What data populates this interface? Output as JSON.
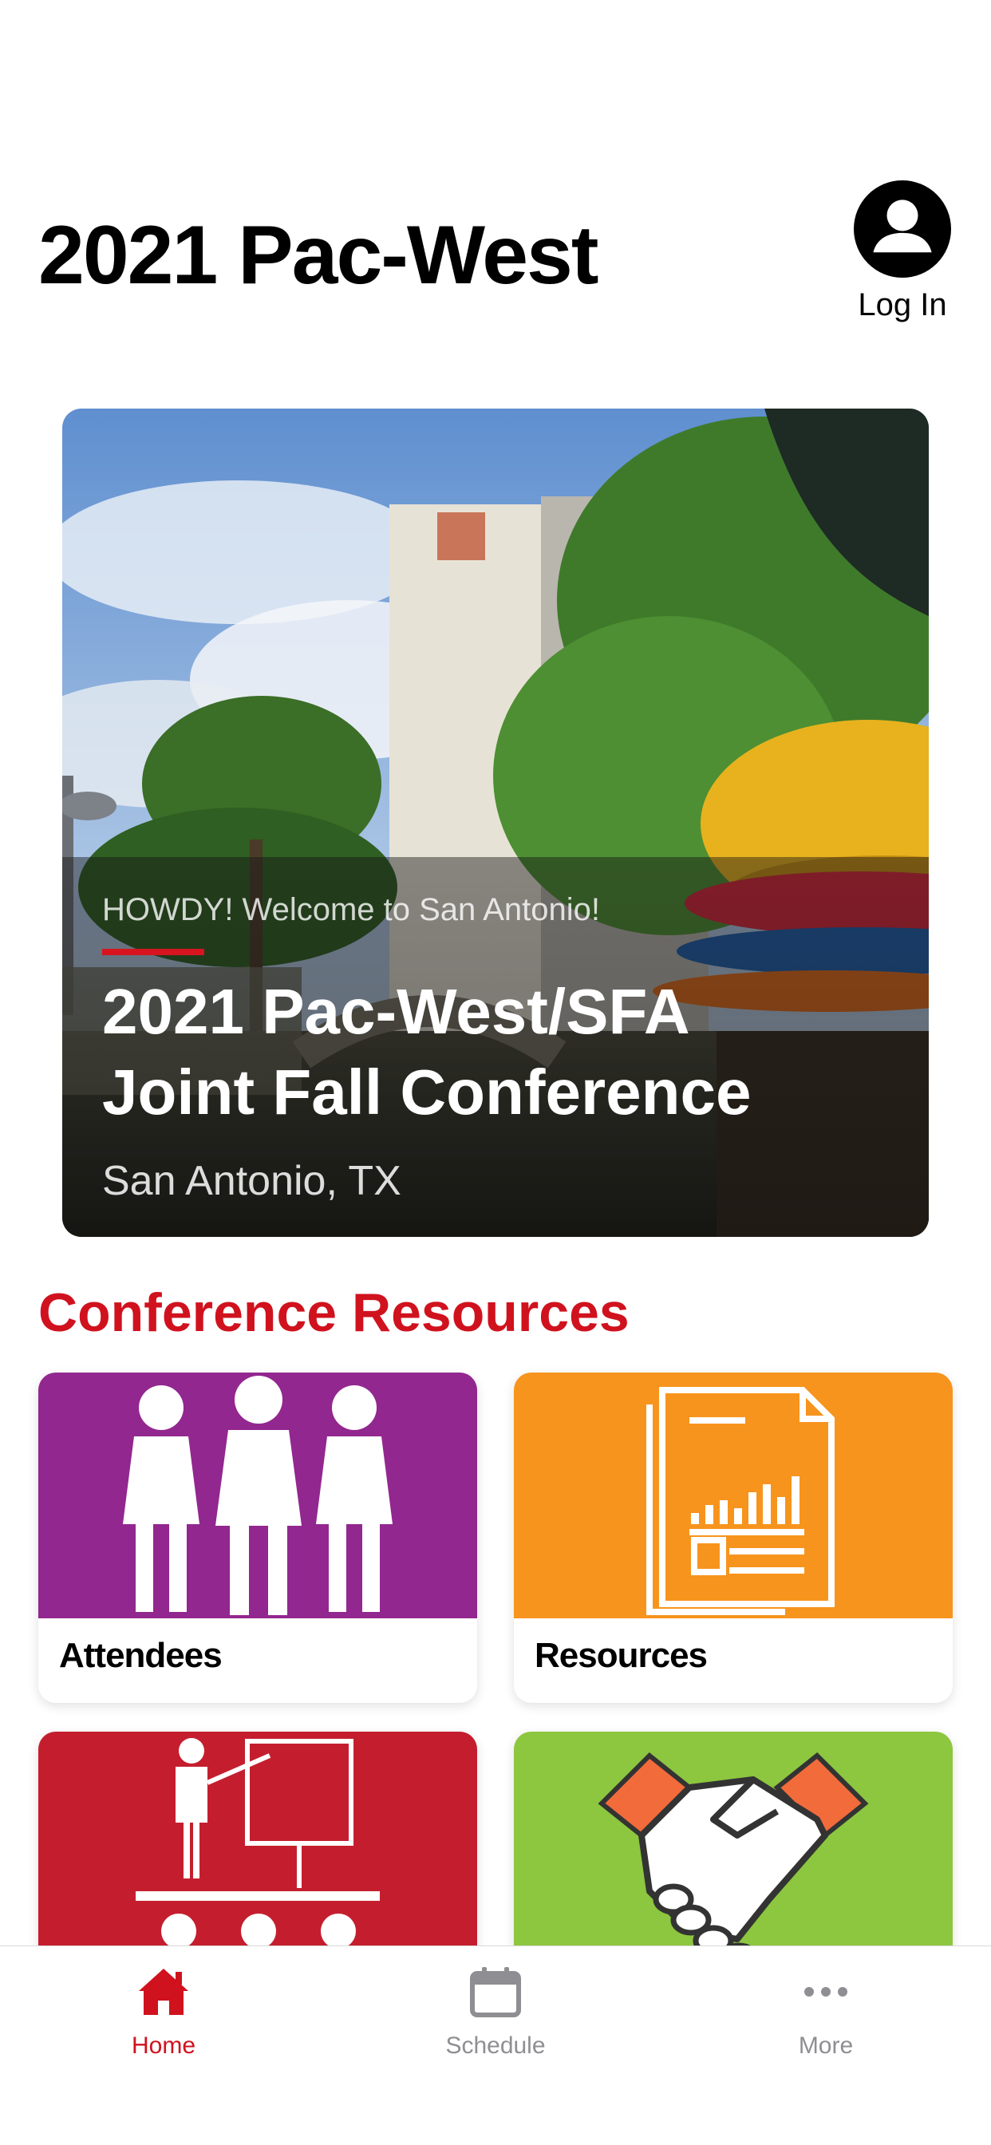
{
  "header": {
    "title": "2021 Pac-West",
    "login_label": "Log In"
  },
  "hero": {
    "kicker": "HOWDY! Welcome to San Antonio!",
    "title": "2021 Pac-West/SFA Joint Fall Conference",
    "location": "San Antonio, TX"
  },
  "resources": {
    "section_title": "Conference Resources",
    "tiles": [
      {
        "label": "Attendees",
        "color": "#92278f",
        "icon": "people-icon"
      },
      {
        "label": "Resources",
        "color": "#f7941d",
        "icon": "document-icon"
      },
      {
        "label": "",
        "color": "#c41e2e",
        "icon": "presentation-icon"
      },
      {
        "label": "",
        "color": "#8dc63f",
        "icon": "handshake-icon"
      }
    ]
  },
  "tabbar": {
    "items": [
      {
        "label": "Home",
        "icon": "home-icon",
        "active": true
      },
      {
        "label": "Schedule",
        "icon": "calendar-icon",
        "active": false
      },
      {
        "label": "More",
        "icon": "more-icon",
        "active": false
      }
    ]
  },
  "colors": {
    "accent": "#d0121e",
    "inactive": "#8e8e93"
  }
}
